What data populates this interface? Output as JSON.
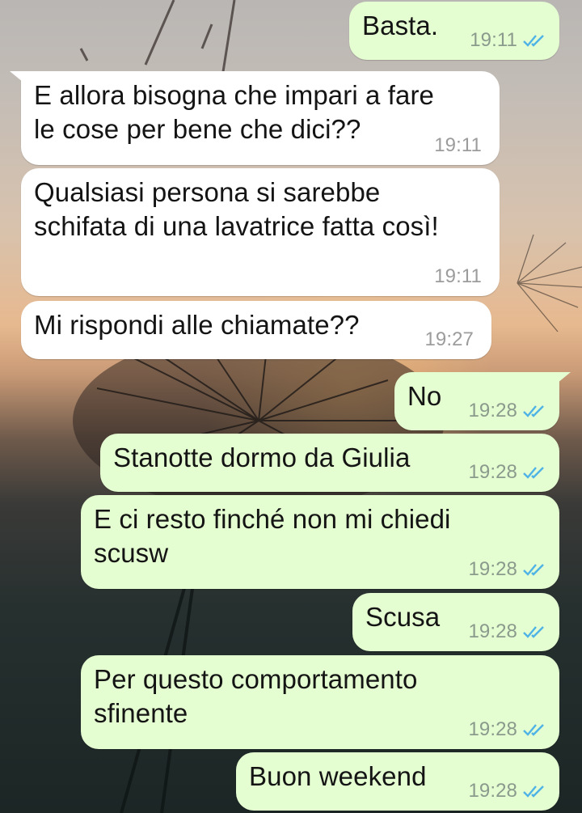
{
  "theme": {
    "incoming_bubble": "#ffffff",
    "outgoing_bubble": "#e4fdd1",
    "read_tick": "#4fb3e6"
  },
  "messages": [
    {
      "dir": "out",
      "text": "Basta.",
      "time": "19:11",
      "status": "read-ticks-icon"
    },
    {
      "dir": "in",
      "text": "E allora bisogna che impari a fare\nle cose per bene che dici??",
      "time": "19:11"
    },
    {
      "dir": "in",
      "text": "Qualsiasi persona si sarebbe\nschifata di una lavatrice fatta così!",
      "time": "19:11"
    },
    {
      "dir": "in",
      "text": "Mi rispondi alle chiamate??",
      "time": "19:27"
    },
    {
      "dir": "out",
      "text": "No",
      "time": "19:28",
      "status": "read-ticks-icon"
    },
    {
      "dir": "out",
      "text": "Stanotte dormo da Giulia",
      "time": "19:28",
      "status": "read-ticks-icon"
    },
    {
      "dir": "out",
      "text": "E ci resto finché non mi chiedi\nscusw",
      "time": "19:28",
      "status": "read-ticks-icon"
    },
    {
      "dir": "out",
      "text": "Scusa",
      "time": "19:28",
      "status": "read-ticks-icon"
    },
    {
      "dir": "out",
      "text": "Per questo comportamento\nsfinente",
      "time": "19:28",
      "status": "read-ticks-icon"
    },
    {
      "dir": "out",
      "text": "Buon weekend",
      "time": "19:28",
      "status": "read-ticks-icon"
    }
  ]
}
